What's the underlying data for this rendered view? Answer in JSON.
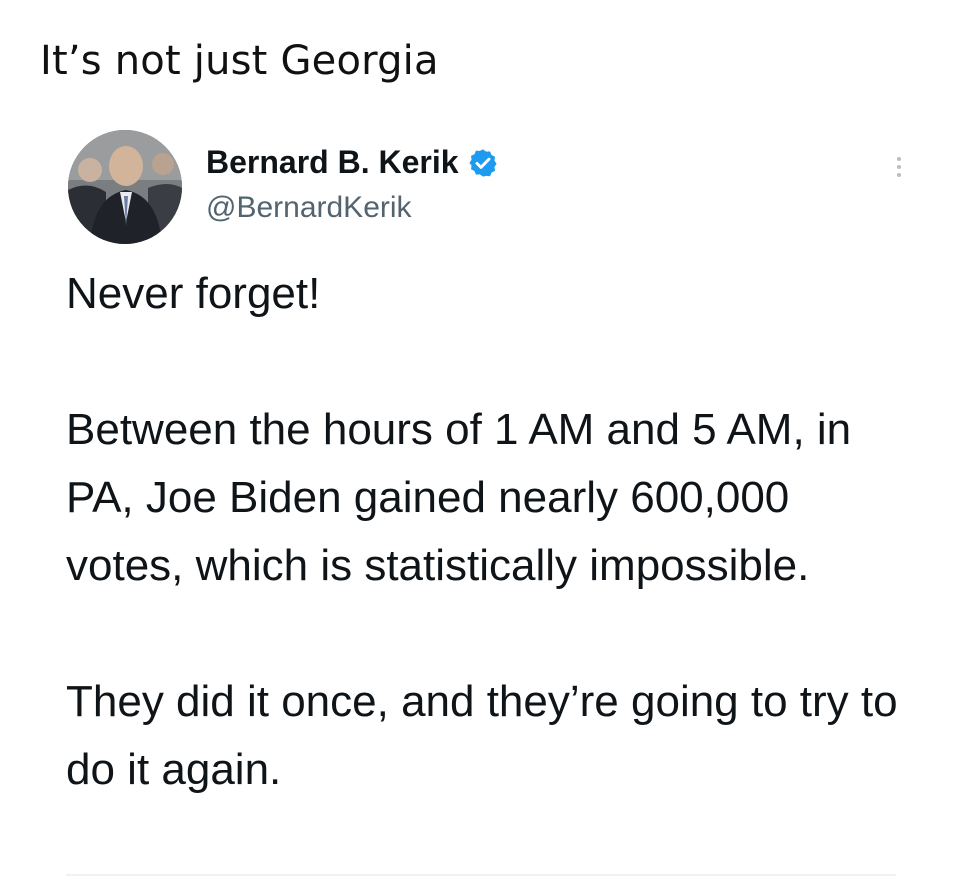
{
  "post": {
    "caption": "It’s not just Georgia"
  },
  "tweet": {
    "author": {
      "display_name": "Bernard B. Kerik",
      "handle": "@BernardKerik",
      "verified": true
    },
    "paragraphs": [
      "Never forget!",
      "Between the hours of 1 AM and 5 AM, in PA, Joe Biden gained nearly 600,000 votes, which is statistically impossible.",
      "They did it once, and they’re going to try to do it again."
    ],
    "icons": {
      "verified": "verified-badge-icon",
      "more": "more-options-icon"
    },
    "colors": {
      "verified_blue": "#1d9bf0",
      "handle_gray": "#536471",
      "text": "#0f1419"
    }
  }
}
